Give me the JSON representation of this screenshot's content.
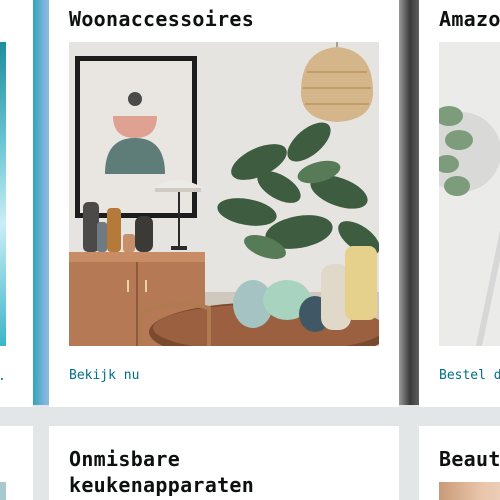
{
  "cards": {
    "left": {
      "link": "."
    },
    "main": {
      "title": "Woonaccessoires",
      "link": "Bekijk nu",
      "image_alt": "living-room-decor-photo"
    },
    "right": {
      "title": "Amazo",
      "link": "Bestel d",
      "image_alt": "succulent-plant-photo"
    },
    "bottom_main": {
      "title_line1": "Onmisbare",
      "title_line2": "keukenapparaten"
    },
    "bottom_right": {
      "title": "Beaut"
    }
  },
  "colors": {
    "page_bg": "#e3e6e6",
    "card_bg": "#ffffff",
    "link": "#007185",
    "title": "#0f1111"
  }
}
